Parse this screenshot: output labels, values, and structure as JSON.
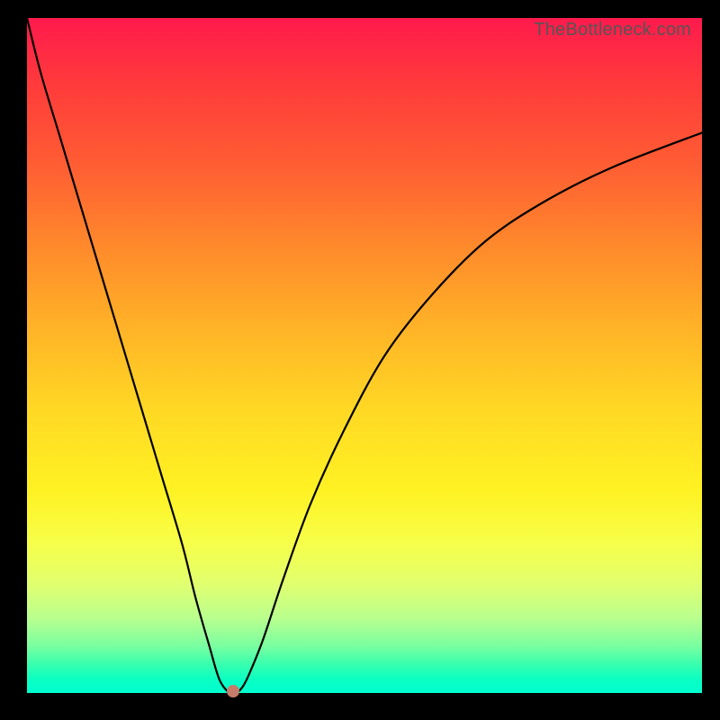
{
  "watermark": "TheBottleneck.com",
  "chart_data": {
    "type": "line",
    "title": "",
    "xlabel": "",
    "ylabel": "",
    "xlim": [
      0,
      100
    ],
    "ylim": [
      0,
      100
    ],
    "series": [
      {
        "name": "bottleneck-curve",
        "x": [
          0,
          2,
          5,
          8,
          11,
          14,
          17,
          20,
          23,
          25,
          27,
          28.5,
          30,
          31,
          32,
          33,
          35,
          38,
          42,
          47,
          53,
          60,
          68,
          77,
          87,
          100
        ],
        "y": [
          100,
          92,
          82,
          72,
          62,
          52,
          42,
          32,
          22,
          14,
          7,
          2,
          0,
          0,
          1,
          3,
          8,
          17,
          28,
          39,
          50,
          59,
          67,
          73,
          78,
          83
        ]
      }
    ],
    "marker": {
      "x": 30.5,
      "y": 0.3
    },
    "gradient_stops": [
      {
        "pos": 0,
        "color": "#ff1a4d"
      },
      {
        "pos": 50,
        "color": "#ffd824"
      },
      {
        "pos": 100,
        "color": "#00ffd0"
      }
    ]
  }
}
